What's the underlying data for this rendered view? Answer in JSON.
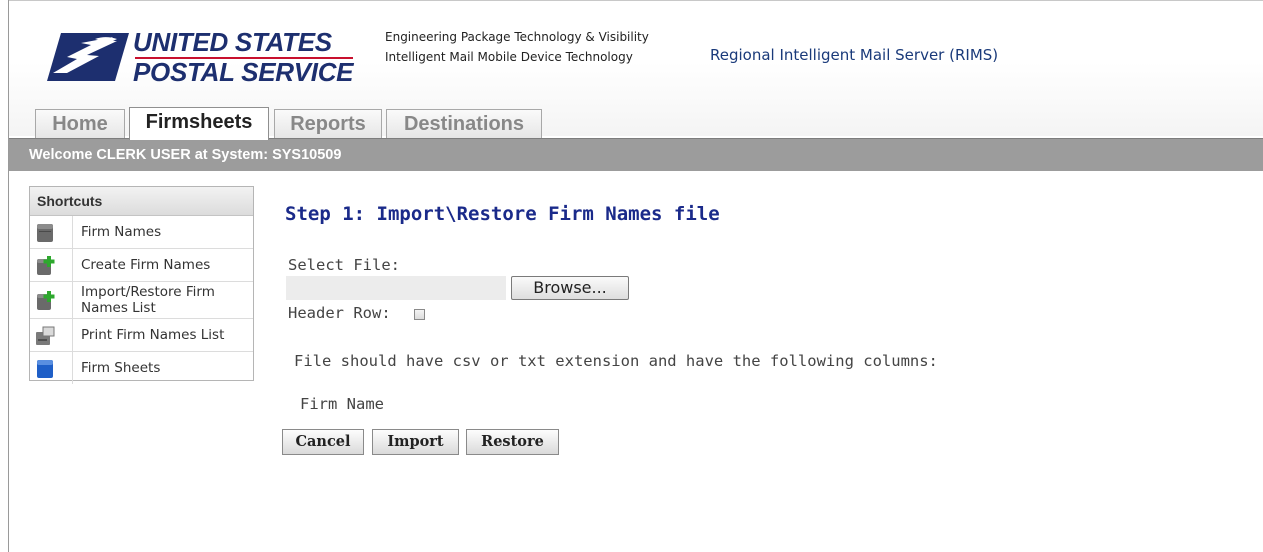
{
  "header": {
    "logo_line1": "UNITED STATES",
    "logo_line2": "POSTAL SERVICE",
    "tagline1": "Engineering Package Technology & Visibility",
    "tagline2": "Intelligent Mail Mobile Device Technology",
    "app_title": "Regional Intelligent Mail Server (RIMS)"
  },
  "tabs": [
    {
      "label": "Home",
      "active": false
    },
    {
      "label": "Firmsheets",
      "active": true
    },
    {
      "label": "Reports",
      "active": false
    },
    {
      "label": "Destinations",
      "active": false
    }
  ],
  "welcome": "Welcome CLERK USER at System: SYS10509",
  "shortcuts": {
    "title": "Shortcuts",
    "items": [
      {
        "label": "Firm Names",
        "icon": "database-icon"
      },
      {
        "label": "Create Firm Names",
        "icon": "database-add-icon"
      },
      {
        "label": "Import/Restore Firm Names List",
        "icon": "database-add-icon"
      },
      {
        "label": "Print Firm Names List",
        "icon": "printer-icon"
      },
      {
        "label": "Firm Sheets",
        "icon": "blue-database-icon"
      }
    ]
  },
  "main": {
    "step_title": "Step 1: Import\\Restore Firm Names file",
    "select_file_label": "Select File:",
    "browse_label": "Browse...",
    "header_row_label": "Header Row:",
    "header_row_checked": false,
    "info_text": "File should have csv or txt extension and have the following columns:",
    "column_name": "Firm Name",
    "buttons": {
      "cancel": "Cancel",
      "import": "Import",
      "restore": "Restore"
    }
  },
  "colors": {
    "brand_blue": "#1d2f6f",
    "brand_red": "#c8102e",
    "title_blue": "#1a2a8a",
    "welcome_bar": "#9c9c9c"
  }
}
